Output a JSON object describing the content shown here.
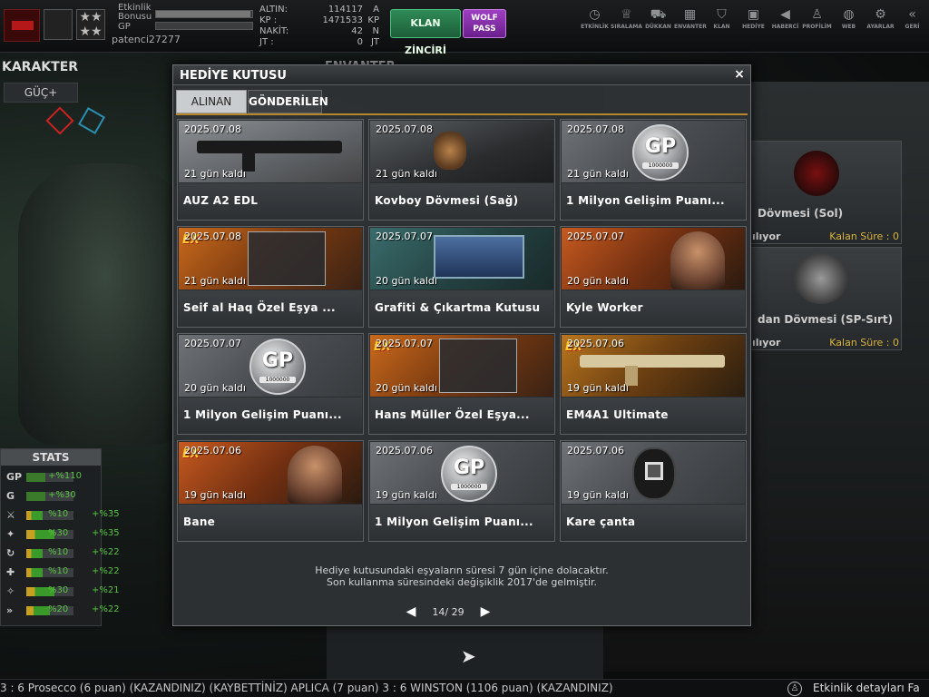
{
  "top": {
    "bonus_label": "Etkinlik Bonusu",
    "gp_label": "GP",
    "username": "patenci27277",
    "currency": [
      {
        "key": "ALTIN:",
        "value": "114117",
        "unit": "A"
      },
      {
        "key": "KP :",
        "value": "1471533",
        "unit": "KP"
      },
      {
        "key": "NAKİT:",
        "value": "42",
        "unit": "N"
      },
      {
        "key": "JT :",
        "value": "0",
        "unit": "JT"
      }
    ],
    "klan_btn": "KLAN ZİNCİRİ",
    "wolf_btn_line1": "WOLF",
    "wolf_btn_line2": "PASS",
    "nav": [
      {
        "icon": "clock-icon",
        "label": "ETKİNLİK"
      },
      {
        "icon": "rank-icon",
        "label": "SIRALAMA"
      },
      {
        "icon": "cart-icon",
        "label": "DÜKKAN"
      },
      {
        "icon": "inventory-icon",
        "label": "ENVANTER"
      },
      {
        "icon": "clan-icon",
        "label": "KLAN"
      },
      {
        "icon": "gift-icon",
        "label": "HEDİYE"
      },
      {
        "icon": "megaphone-icon",
        "label": "HABERCİ"
      },
      {
        "icon": "profile-icon",
        "label": "PROFİLİM"
      },
      {
        "icon": "web-icon",
        "label": "WEB"
      },
      {
        "icon": "settings-icon",
        "label": "AYARLAR"
      },
      {
        "icon": "back-icon",
        "label": "GERİ"
      }
    ]
  },
  "left": {
    "title": "KARAKTER",
    "guc_btn": "GÜÇ+",
    "stats_title": "STATS",
    "stats": [
      {
        "icon": "GP",
        "v1": "+%110",
        "v2": ""
      },
      {
        "icon": "G",
        "v1": "+%30",
        "v2": ""
      },
      {
        "icon": "⚔",
        "v1": "%10",
        "v2": "+%35"
      },
      {
        "icon": "✦",
        "v1": "%30",
        "v2": "+%35"
      },
      {
        "icon": "↻",
        "v1": "%10",
        "v2": "+%22"
      },
      {
        "icon": "✚",
        "v1": "%10",
        "v2": "+%22"
      },
      {
        "icon": "✧",
        "v1": "%30",
        "v2": "+%21"
      },
      {
        "icon": "»",
        "v1": "%20",
        "v2": "+%22"
      }
    ],
    "stat_bar_levels": [
      0.4,
      0.4,
      0.35,
      0.6,
      0.35,
      0.35,
      0.6,
      0.5
    ]
  },
  "right": {
    "title": "ENVANTER",
    "items": [
      {
        "name": "Dövmesi (Sol)",
        "status": "ılıyor",
        "kalan": "Kalan Süre : 0"
      },
      {
        "name": "dan Dövmesi (SP-Sırt)",
        "status": "ılıyor",
        "kalan": "Kalan Süre : 0"
      }
    ]
  },
  "modal": {
    "title": "HEDİYE KUTUSU",
    "close": "×",
    "tabs": [
      "ALINAN",
      "GÖNDERİLEN"
    ],
    "items": [
      {
        "date": "2025.07.08",
        "days": "21 gün kaldı",
        "name": "AUZ A2 EDL",
        "kind": "gun"
      },
      {
        "date": "2025.07.08",
        "days": "21 gün kaldı",
        "name": "Kovboy Dövmesi (Sağ)",
        "kind": "tattoo"
      },
      {
        "date": "2025.07.08",
        "days": "21 gün kaldı",
        "name": "1 Milyon Gelişim Puanı...",
        "kind": "gp"
      },
      {
        "date": "2025.07.08",
        "days": "21 gün kaldı",
        "name": "Seif al Haq Özel Eşya ...",
        "kind": "set",
        "ex": "EX"
      },
      {
        "date": "2025.07.07",
        "days": "20 gün kaldı",
        "name": "Grafiti & Çıkartma Kutusu",
        "kind": "box"
      },
      {
        "date": "2025.07.07",
        "days": "20 gün kaldı",
        "name": "Kyle Worker",
        "kind": "soldier"
      },
      {
        "date": "2025.07.07",
        "days": "20 gün kaldı",
        "name": "1 Milyon Gelişim Puanı...",
        "kind": "gp"
      },
      {
        "date": "2025.07.07",
        "days": "20 gün kaldı",
        "name": "Hans Müller Özel Eşya...",
        "kind": "set2",
        "ex": "EX"
      },
      {
        "date": "2025.07.06",
        "days": "19 gün kaldı",
        "name": "EM4A1 Ultimate",
        "kind": "goldgun",
        "ex": "EX"
      },
      {
        "date": "2025.07.06",
        "days": "19 gün kaldı",
        "name": "Bane",
        "kind": "soldier2",
        "ex": "EX"
      },
      {
        "date": "2025.07.06",
        "days": "19 gün kaldı",
        "name": "1 Milyon Gelişim Puanı...",
        "kind": "gp"
      },
      {
        "date": "2025.07.06",
        "days": "19 gün kaldı",
        "name": "Kare çanta",
        "kind": "bag"
      }
    ],
    "gp_text": "GP",
    "gp_sub": "1000000",
    "notice_line1": "Hediye kutusundaki eşyaların süresi 7 gün içine dolacaktır.",
    "notice_line2": "Son kullanma süresindeki değişiklik 2017'de gelmiştir.",
    "page": "14/ 29"
  },
  "ticker": {
    "text": "3 : 6 Prosecco (6 puan) (KAZANDINIZ)          (KAYBETTİNİZ) APLICA (7 puan) 3 : 6 WINSTON (1106 puan) (KAZANDINIZ)",
    "event": "Etkinlik detayları Fa"
  },
  "colors": {
    "accent_tab": "#b7862c",
    "klan_green": "#2f8b57",
    "wolf_purple": "#9e3fc2",
    "stat_green": "#58c341",
    "kalan_gold": "#d8b43a"
  }
}
